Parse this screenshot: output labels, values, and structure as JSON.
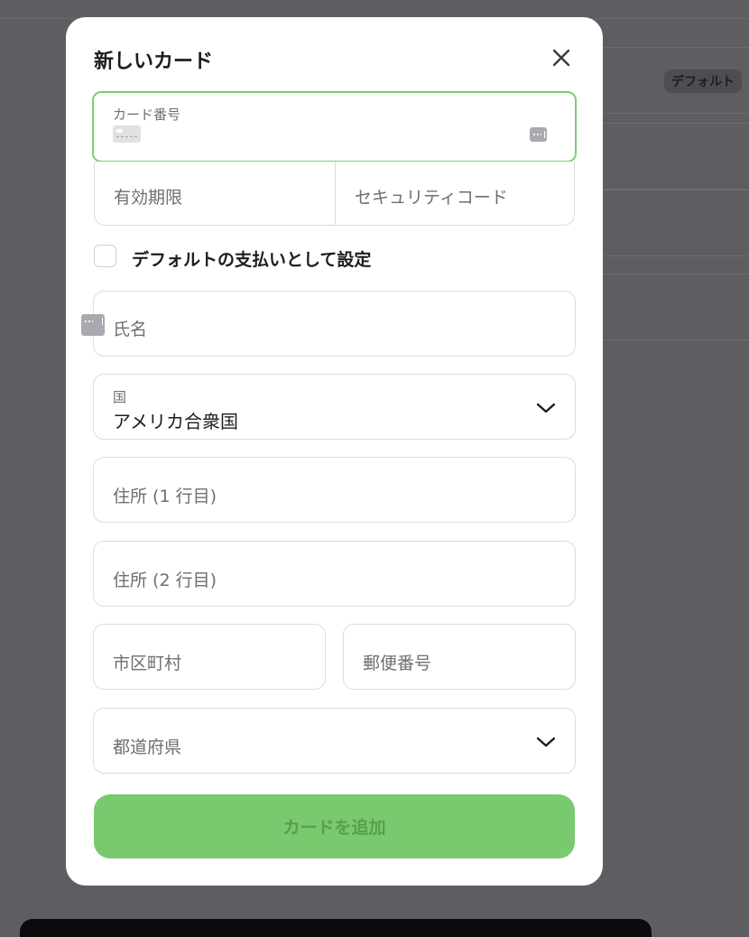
{
  "background": {
    "default_badge": "デフォルト"
  },
  "modal": {
    "title": "新しいカード",
    "close_icon": "close-icon",
    "card_number": {
      "label": "カード番号",
      "brand_icon": "generic-card-icon",
      "autofill_icon": "autofill-key-icon"
    },
    "expiry": {
      "placeholder": "有効期限"
    },
    "cvc": {
      "placeholder": "セキュリティコード"
    },
    "default_checkbox": {
      "label": "デフォルトの支払いとして設定",
      "checked": false
    },
    "name": {
      "placeholder": "氏名",
      "autofill_icon": "autofill-key-icon"
    },
    "country": {
      "label": "国",
      "value": "アメリカ合衆国",
      "icon": "chevron-down-icon"
    },
    "address1": {
      "placeholder": "住所 (1 行目)"
    },
    "address2": {
      "placeholder": "住所 (2 行目)"
    },
    "city": {
      "placeholder": "市区町村"
    },
    "postal_code": {
      "placeholder": "郵便番号"
    },
    "prefecture": {
      "placeholder": "都道府県",
      "icon": "chevron-down-icon"
    },
    "submit_label": "カードを追加"
  },
  "colors": {
    "accent": "#79c96f",
    "focus_border": "#7dcd75",
    "overlay": "#5e5d62"
  }
}
